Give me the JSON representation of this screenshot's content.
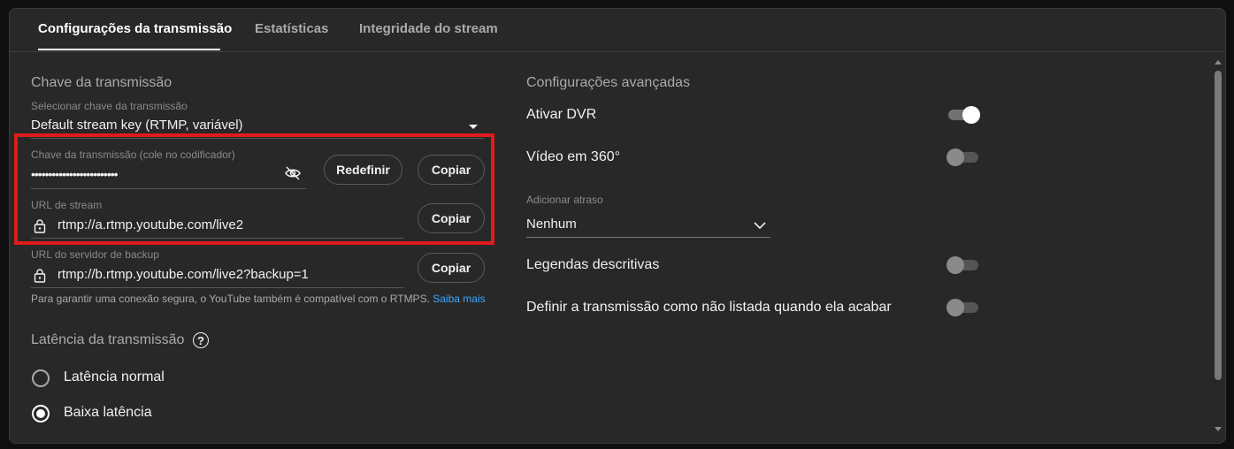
{
  "tabs": [
    {
      "label": "Configurações da transmissão",
      "active": true
    },
    {
      "label": "Estatísticas",
      "active": false
    },
    {
      "label": "Integridade do stream",
      "active": false
    }
  ],
  "stream_key_section": {
    "title": "Chave da transmissão",
    "select_label": "Selecionar chave da transmissão",
    "select_value": "Default stream key (RTMP, variável)",
    "key_label": "Chave da transmissão (cole no codificador)",
    "key_value": "•••••••••••••••••••••••••",
    "reset_label": "Redefinir",
    "copy_label": "Copiar",
    "url_label": "URL de stream",
    "url_value": "rtmp://a.rtmp.youtube.com/live2",
    "backup_label": "URL do servidor de backup",
    "backup_value": "rtmp://b.rtmp.youtube.com/live2?backup=1",
    "note_text": "Para garantir uma conexão segura, o YouTube também é compatível com o RTMPS.",
    "note_link": "Saiba mais"
  },
  "latency_section": {
    "title": "Latência da transmissão",
    "help": "?",
    "options": [
      {
        "label": "Latência normal",
        "checked": false
      },
      {
        "label": "Baixa latência",
        "checked": true
      }
    ]
  },
  "advanced_section": {
    "title": "Configurações avançadas",
    "dvr_label": "Ativar DVR",
    "dvr_on": true,
    "video360_label": "Vídeo em 360°",
    "video360_on": false,
    "delay_label": "Adicionar atraso",
    "delay_value": "Nenhum",
    "captions_label": "Legendas descritivas",
    "captions_on": false,
    "unlisted_label": "Definir a transmissão como não listada quando ela acabar",
    "unlisted_on": false
  },
  "colors": {
    "background": "#0f0f0f",
    "panel": "#282828",
    "highlight": "#e01b1b",
    "link": "#3ea6ff"
  }
}
